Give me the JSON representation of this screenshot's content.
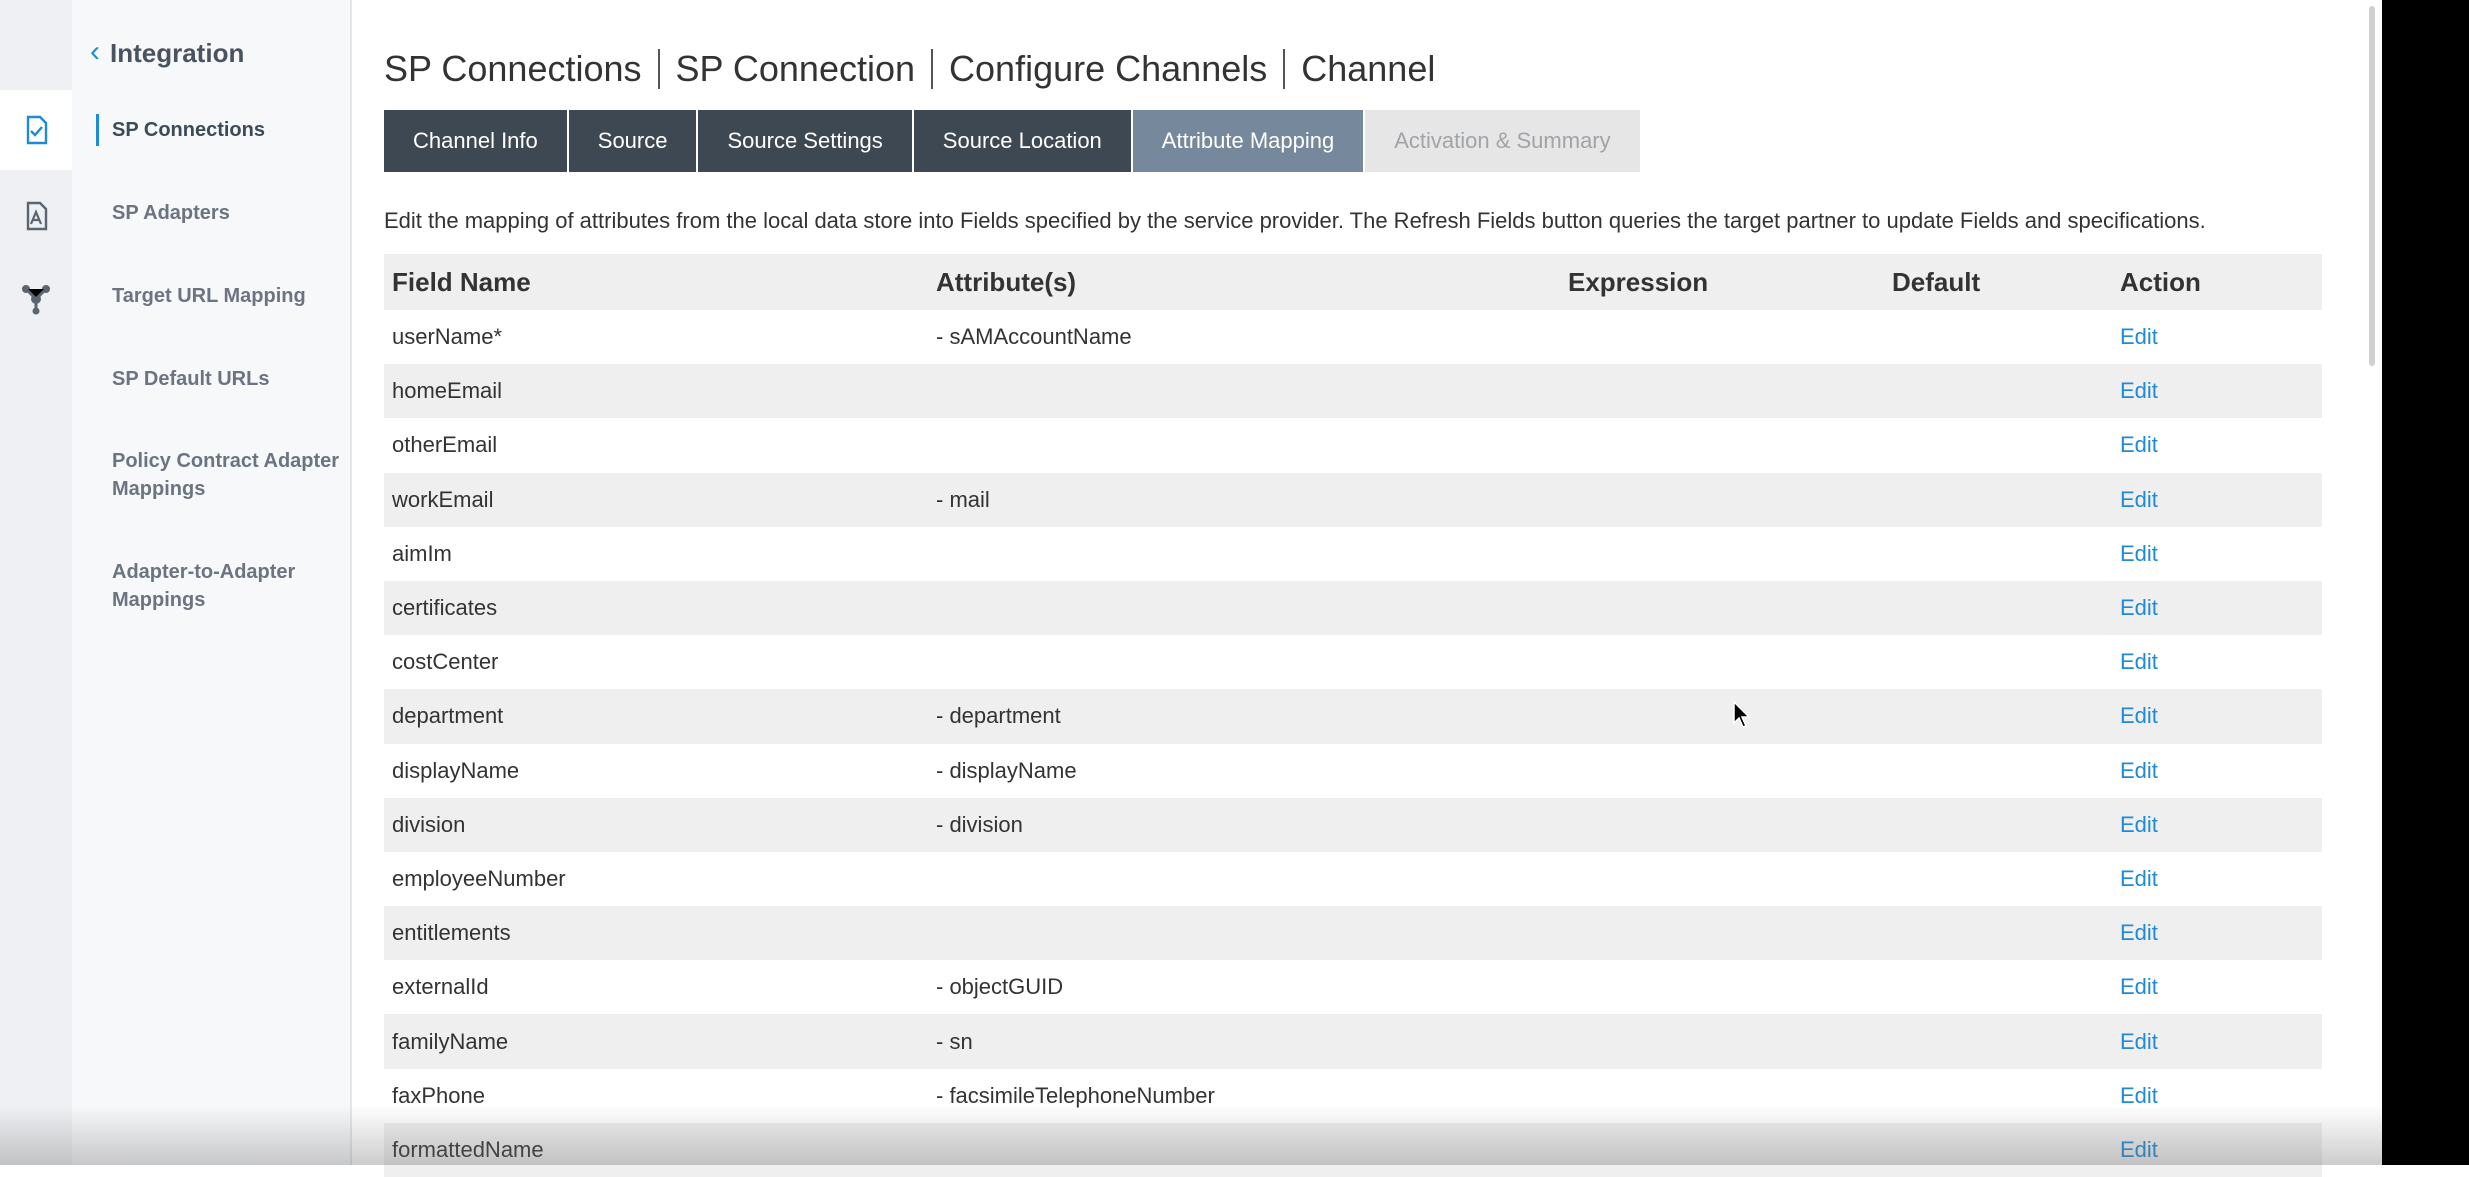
{
  "sidebar": {
    "title": "Integration",
    "items": [
      {
        "label": "SP Connections"
      },
      {
        "label": "SP Adapters"
      },
      {
        "label": "Target URL Mapping"
      },
      {
        "label": "SP Default URLs"
      },
      {
        "label": "Policy Contract Adapter Mappings"
      },
      {
        "label": "Adapter-to-Adapter Mappings"
      }
    ],
    "rail_icons": [
      "document-check-icon",
      "document-a-icon",
      "network-hub-icon"
    ]
  },
  "breadcrumb": [
    "SP Connections",
    "SP Connection",
    "Configure Channels",
    "Channel"
  ],
  "tabs": [
    {
      "label": "Channel Info",
      "state": "normal"
    },
    {
      "label": "Source",
      "state": "normal"
    },
    {
      "label": "Source Settings",
      "state": "normal"
    },
    {
      "label": "Source Location",
      "state": "normal"
    },
    {
      "label": "Attribute Mapping",
      "state": "selected"
    },
    {
      "label": "Activation & Summary",
      "state": "disabled"
    }
  ],
  "description": "Edit the mapping of attributes from the local data store into Fields specified by the service provider. The Refresh Fields button queries the target partner to update Fields and specifications.",
  "table": {
    "columns": [
      "Field Name",
      "Attribute(s)",
      "Expression",
      "Default",
      "Action"
    ],
    "rows": [
      {
        "field": "userName*",
        "attribute": "- sAMAccountName",
        "expression": "",
        "default": "",
        "action": "Edit"
      },
      {
        "field": "homeEmail",
        "attribute": "",
        "expression": "",
        "default": "",
        "action": "Edit"
      },
      {
        "field": "otherEmail",
        "attribute": "",
        "expression": "",
        "default": "",
        "action": "Edit"
      },
      {
        "field": "workEmail",
        "attribute": "- mail",
        "expression": "",
        "default": "",
        "action": "Edit"
      },
      {
        "field": "aimIm",
        "attribute": "",
        "expression": "",
        "default": "",
        "action": "Edit"
      },
      {
        "field": "certificates",
        "attribute": "",
        "expression": "",
        "default": "",
        "action": "Edit"
      },
      {
        "field": "costCenter",
        "attribute": "",
        "expression": "",
        "default": "",
        "action": "Edit"
      },
      {
        "field": "department",
        "attribute": "- department",
        "expression": "",
        "default": "",
        "action": "Edit"
      },
      {
        "field": "displayName",
        "attribute": "- displayName",
        "expression": "",
        "default": "",
        "action": "Edit"
      },
      {
        "field": "division",
        "attribute": "- division",
        "expression": "",
        "default": "",
        "action": "Edit"
      },
      {
        "field": "employeeNumber",
        "attribute": "",
        "expression": "",
        "default": "",
        "action": "Edit"
      },
      {
        "field": "entitlements",
        "attribute": "",
        "expression": "",
        "default": "",
        "action": "Edit"
      },
      {
        "field": "externalId",
        "attribute": "- objectGUID",
        "expression": "",
        "default": "",
        "action": "Edit"
      },
      {
        "field": "familyName",
        "attribute": "- sn",
        "expression": "",
        "default": "",
        "action": "Edit"
      },
      {
        "field": "faxPhone",
        "attribute": "- facsimileTelephoneNumber",
        "expression": "",
        "default": "",
        "action": "Edit"
      },
      {
        "field": "formattedName",
        "attribute": "",
        "expression": "",
        "default": "",
        "action": "Edit"
      }
    ]
  },
  "colors": {
    "accent": "#1f8ad6",
    "tab_dark": "#3e4852",
    "tab_selected": "#76889b",
    "tab_disabled": "#e6e6e6"
  }
}
